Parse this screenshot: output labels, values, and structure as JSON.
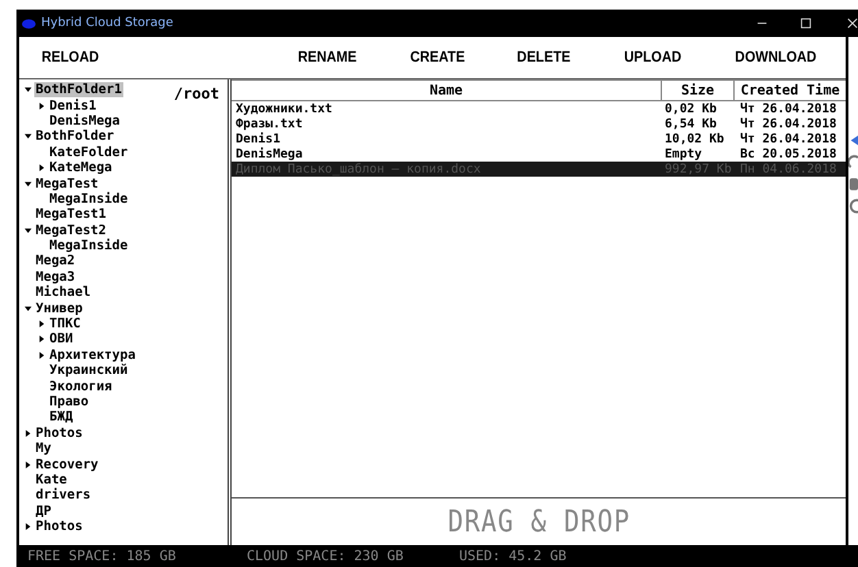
{
  "window": {
    "title": "Hybrid Cloud Storage"
  },
  "toolbar": {
    "left": [
      "RELOAD"
    ],
    "right": [
      "RENAME",
      "CREATE",
      "DELETE",
      "UPLOAD",
      "DOWNLOAD"
    ]
  },
  "tree": {
    "path": "/root",
    "items": [
      {
        "label": "BothFolder1",
        "selected": true,
        "expanded": true,
        "children": [
          {
            "label": "Denis1",
            "selected": false,
            "expanded": false
          },
          {
            "label": "DenisMega",
            "selected": false
          }
        ]
      },
      {
        "label": "BothFolder",
        "selected": false,
        "expanded": true,
        "children": [
          {
            "label": "KateFolder",
            "selected": false
          },
          {
            "label": "KateMega",
            "selected": false,
            "expanded": false
          }
        ]
      },
      {
        "label": "MegaTest",
        "selected": false,
        "expanded": true,
        "children": [
          {
            "label": "MegaInside",
            "selected": false
          }
        ]
      },
      {
        "label": "MegaTest1",
        "selected": false
      },
      {
        "label": "MegaTest2",
        "selected": false,
        "expanded": true,
        "children": [
          {
            "label": "MegaInside",
            "selected": false
          }
        ]
      },
      {
        "label": "Mega2",
        "selected": false
      },
      {
        "label": "Mega3",
        "selected": false
      },
      {
        "label": "Michael",
        "selected": false
      },
      {
        "label": "Универ",
        "selected": false,
        "expanded": true,
        "children": [
          {
            "label": "ТПКС",
            "selected": false,
            "expanded": false
          },
          {
            "label": "ОВИ",
            "selected": false,
            "expanded": false
          },
          {
            "label": "Архитектура",
            "selected": false,
            "expanded": false
          },
          {
            "label": "Украинский",
            "selected": false
          },
          {
            "label": "Экология",
            "selected": false
          },
          {
            "label": "Право",
            "selected": false
          },
          {
            "label": "БЖД",
            "selected": false
          }
        ]
      },
      {
        "label": "Photos",
        "selected": false,
        "expanded": false
      },
      {
        "label": "My",
        "selected": false
      },
      {
        "label": "Recovery",
        "selected": false,
        "expanded": false
      },
      {
        "label": "Kate",
        "selected": false
      },
      {
        "label": "drivers",
        "selected": false
      },
      {
        "label": "ДР",
        "selected": false
      },
      {
        "label": "Photos",
        "selected": false,
        "expanded": false
      }
    ]
  },
  "table": {
    "columns": [
      "Name",
      "Size",
      "Created Time"
    ],
    "rows": [
      {
        "cells": [
          "Художники.txt",
          "0,02 Kb",
          "Чт 26.04.2018"
        ],
        "selected": false
      },
      {
        "cells": [
          "Фразы.txt",
          "6,54 Kb",
          "Чт 26.04.2018"
        ],
        "selected": false
      },
      {
        "cells": [
          "Denis1",
          "10,02 Kb",
          "Чт 26.04.2018"
        ],
        "selected": false
      },
      {
        "cells": [
          "DenisMega",
          "Empty",
          "Вс 20.05.2018"
        ],
        "selected": false
      },
      {
        "cells": [
          "Диплом Пасько_шаблон — копия.docx",
          "992,97 Kb",
          "Пн 04.06.2018"
        ],
        "selected": true
      }
    ]
  },
  "drop_zone": {
    "label": "DRAG & DROP"
  },
  "status_bar": {
    "free": "FREE SPACE: 185 GB",
    "cloud": "CLOUD SPACE: 230 GB",
    "used": "USED: 45.2 GB"
  }
}
